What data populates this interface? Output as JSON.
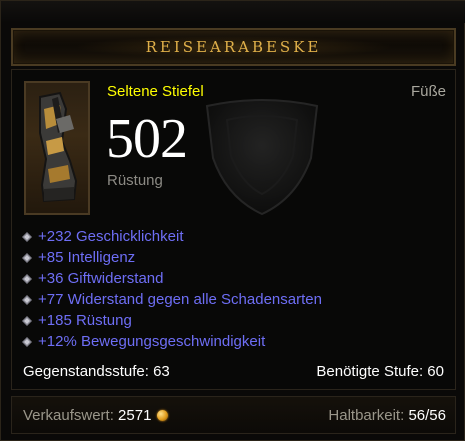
{
  "item": {
    "name": "REISEARABESKE",
    "type": "Seltene Stiefel",
    "slot": "Füße",
    "armor_value": "502",
    "armor_label": "Rüstung"
  },
  "affixes": [
    "+232 Geschicklichkeit",
    "+85 Intelligenz",
    "+36 Giftwiderstand",
    "+77 Widerstand gegen alle Schadensarten",
    "+185 Rüstung",
    "+12% Bewegungsgeschwindigkeit"
  ],
  "requirements": {
    "item_level": "Gegenstandsstufe: 63",
    "required_level": "Benötigte Stufe: 60"
  },
  "footer": {
    "sell_label": "Verkaufswert:",
    "sell_value": "2571",
    "durability_label": "Haltbarkeit:",
    "durability_value": "56/56"
  },
  "icons": {
    "item_icon": "boots-icon",
    "background_icon": "shield-icon",
    "affix_bullet": "diamond-bullet-icon",
    "currency_icon": "gold-coin-icon"
  },
  "colors": {
    "title_gold": "#e0b04a",
    "rare_yellow": "#ffff00",
    "affix_blue": "#6e6ef5"
  }
}
